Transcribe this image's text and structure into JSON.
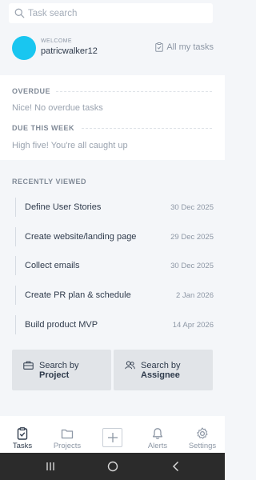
{
  "search": {
    "placeholder": "Task search"
  },
  "profile": {
    "welcome": "WELCOME",
    "username": "patricwalker12",
    "all_tasks_label": "All my tasks",
    "avatar_color": "#19c6f0"
  },
  "overdue": {
    "heading": "OVERDUE",
    "message": "Nice! No overdue tasks"
  },
  "due_this_week": {
    "heading": "DUE THIS WEEK",
    "message": "High five! You're all caught up"
  },
  "recently_viewed": {
    "heading": "RECENTLY VIEWED",
    "items": [
      {
        "title": "Define User Stories",
        "date": "30 Dec 2025"
      },
      {
        "title": "Create website/landing page",
        "date": "29 Dec 2025"
      },
      {
        "title": "Collect emails",
        "date": "30 Dec 2025"
      },
      {
        "title": "Create PR plan & schedule",
        "date": "2 Jan 2026"
      },
      {
        "title": "Build product MVP",
        "date": "14 Apr 2026"
      }
    ]
  },
  "search_by": {
    "project": {
      "line1": "Search by",
      "line2": "Project",
      "icon": "briefcase-icon"
    },
    "assignee": {
      "line1": "Search by",
      "line2": "Assignee",
      "icon": "users-icon"
    }
  },
  "bottom_nav": {
    "items": [
      {
        "label": "Tasks",
        "icon": "clipboard-icon",
        "active": true
      },
      {
        "label": "Projects",
        "icon": "folder-icon",
        "active": false
      },
      {
        "label": "",
        "icon": "plus-icon",
        "active": false
      },
      {
        "label": "Alerts",
        "icon": "bell-icon",
        "active": false
      },
      {
        "label": "Settings",
        "icon": "gear-icon",
        "active": false
      }
    ]
  },
  "system_nav": {
    "icons": [
      "recents-icon",
      "home-icon",
      "back-icon"
    ]
  }
}
